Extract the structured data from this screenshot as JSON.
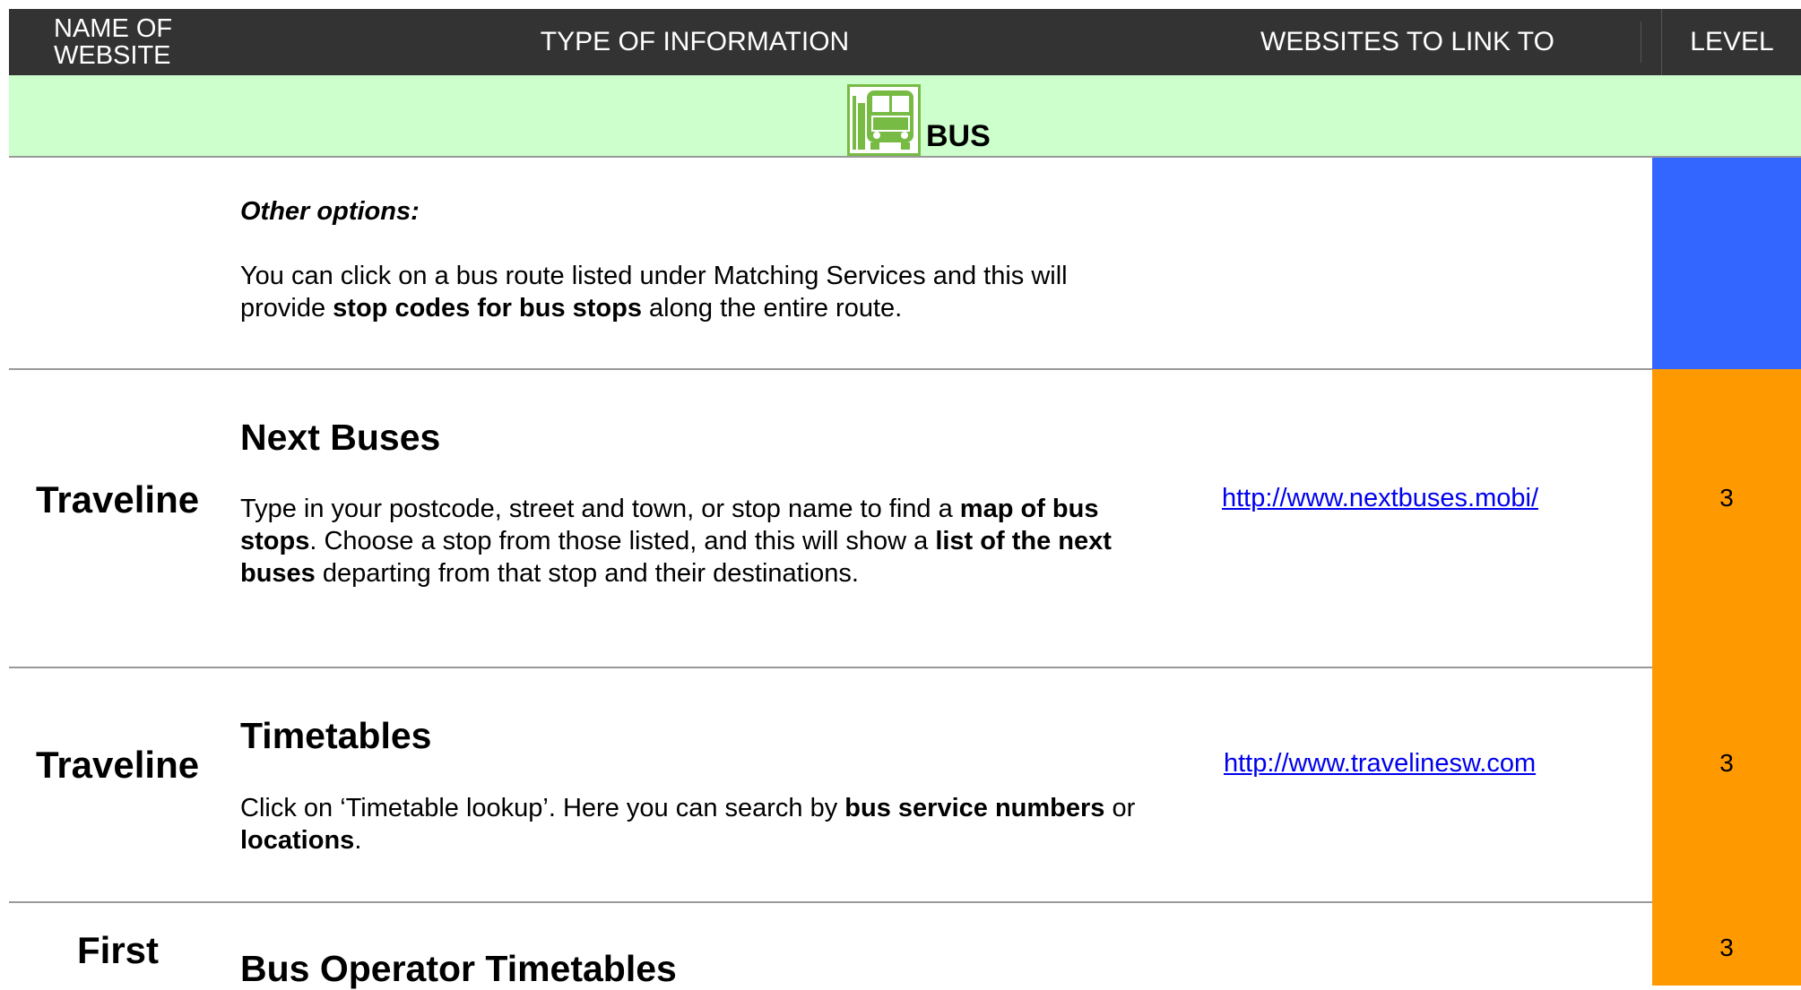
{
  "header": {
    "name_col": "NAME OF WEBSITE",
    "type_col": "TYPE OF INFORMATION",
    "links_col": "WEBSITES TO LINK TO",
    "level_col": "LEVEL"
  },
  "section": {
    "title": "BUS",
    "icon": "bus-stop-icon",
    "icon_color": "#77bb44",
    "band_color": "#ccffcc"
  },
  "colors": {
    "level_blue": "#3366ff",
    "level_orange": "#ff9900"
  },
  "rows": [
    {
      "name": "",
      "heading": "Other options:",
      "text_a": "You can click on a bus route listed under Matching Services and this will provide ",
      "bold_a": "stop codes for bus stops",
      "text_b": " along the entire route.",
      "link": "",
      "level": ""
    },
    {
      "name": "Traveline",
      "heading": "Next Buses",
      "text_a": "Type in your postcode, street and town, or stop name to find a ",
      "bold_a": "map of bus stops",
      "text_b": ". Choose a stop from those listed, and this will show a ",
      "bold_b": "list of the next buses",
      "text_c": " departing from that stop and their destinations.",
      "link": "http://www.nextbuses.mobi/",
      "level": "3"
    },
    {
      "name": "Traveline",
      "heading": "Timetables",
      "text_a": "Click on ‘Timetable lookup’. Here you can search by ",
      "bold_a": "bus service numbers",
      "text_b": " or ",
      "bold_b": "locations",
      "text_c": ".",
      "link": "http://www.travelinesw.com",
      "level": "3"
    },
    {
      "name": "First",
      "heading": "Bus Operator Timetables",
      "link": "",
      "level": "3"
    }
  ]
}
